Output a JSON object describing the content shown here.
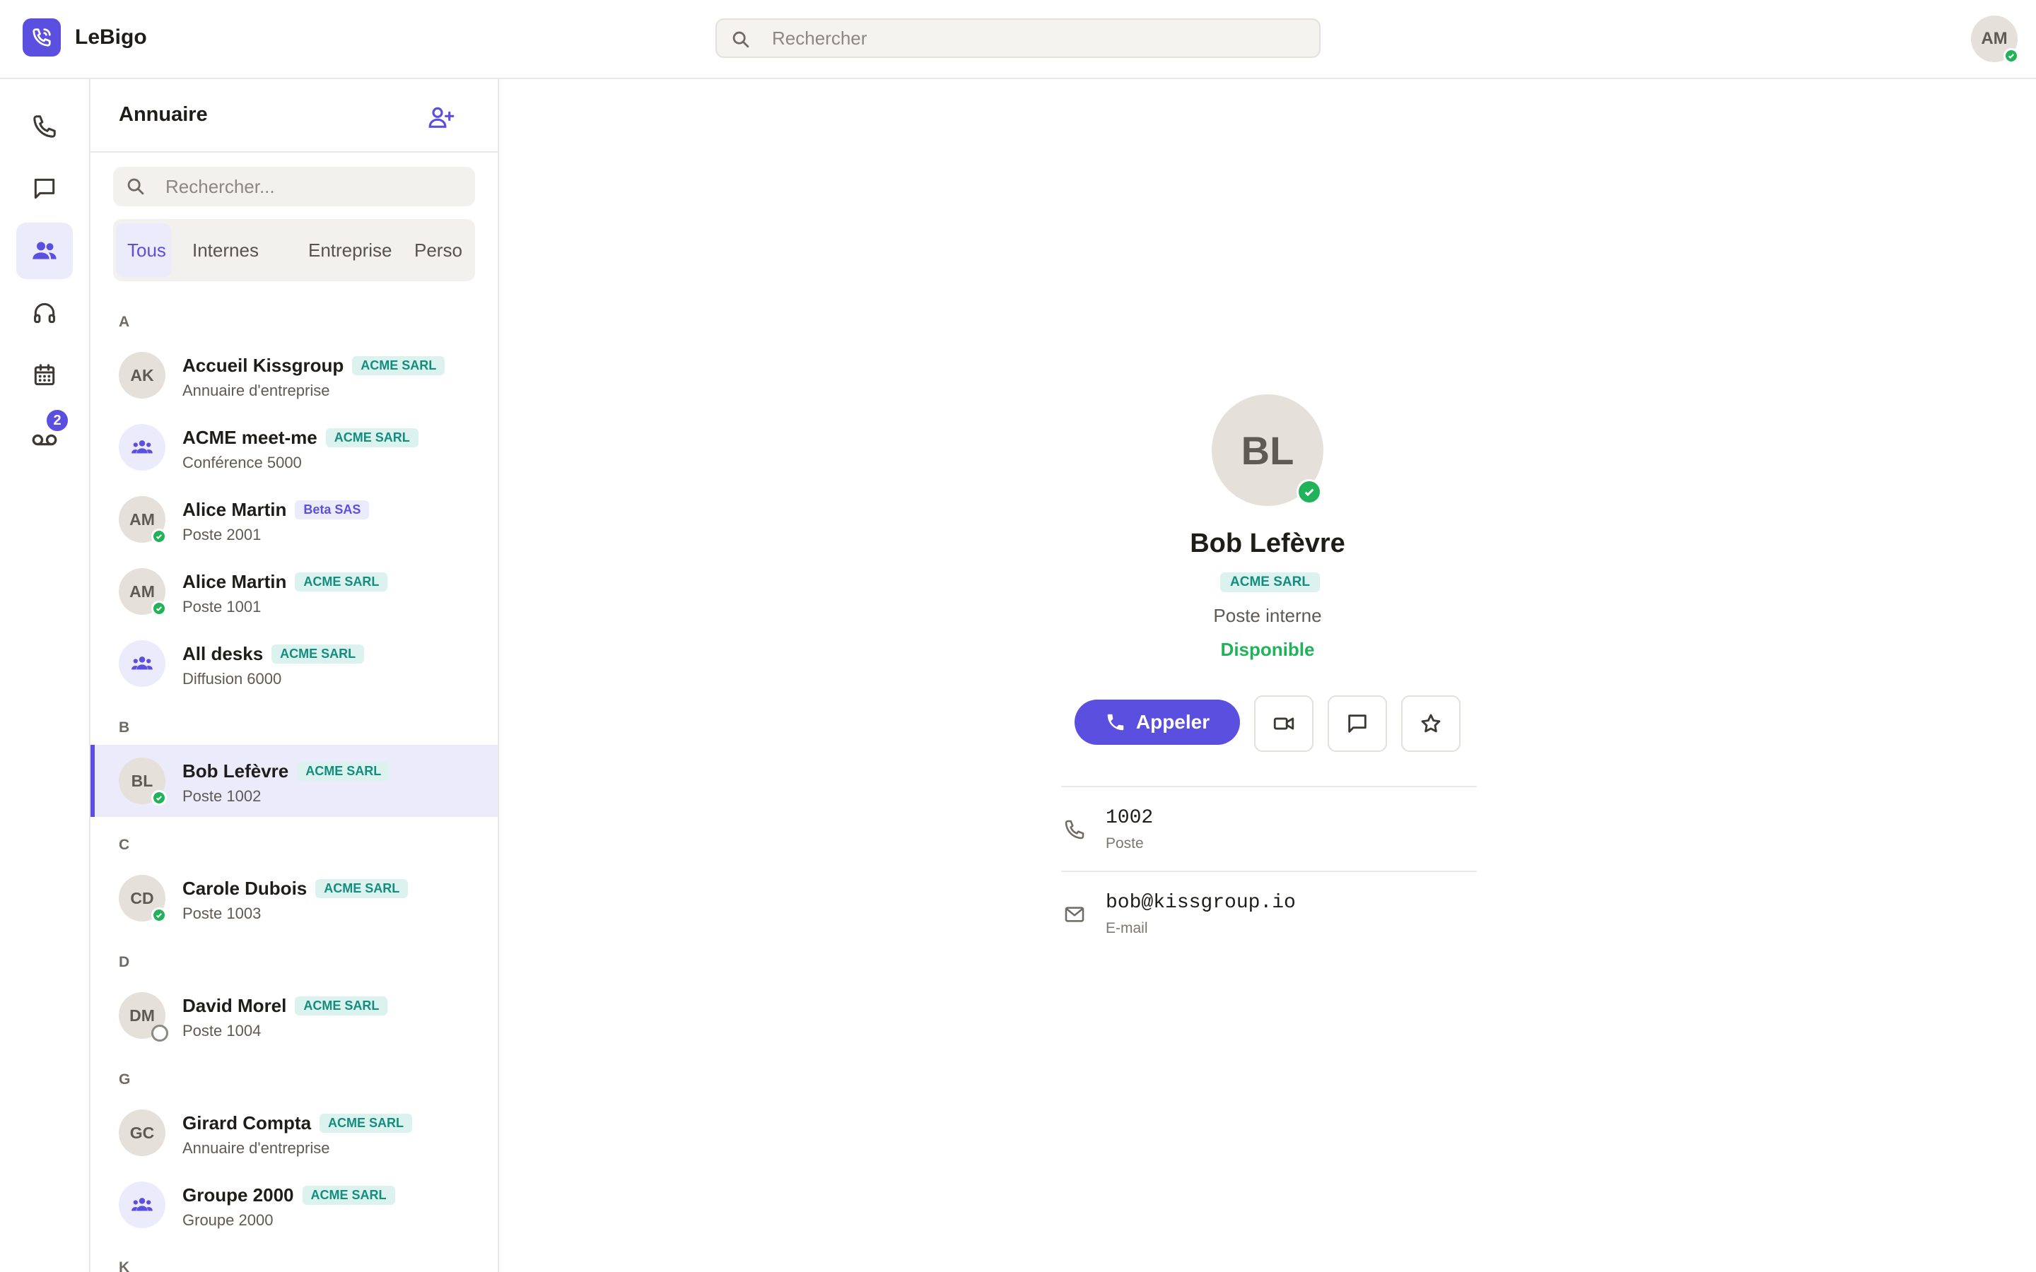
{
  "app": {
    "name": "LeBigo",
    "search_placeholder": "Rechercher",
    "user_initials": "AM"
  },
  "rail": {
    "items": [
      {
        "icon": "phone-icon",
        "active": false
      },
      {
        "icon": "chat-icon",
        "active": false
      },
      {
        "icon": "contacts-icon",
        "active": true
      },
      {
        "icon": "headset-icon",
        "active": false
      },
      {
        "icon": "calendar-icon",
        "active": false
      },
      {
        "icon": "voicemail-icon",
        "active": false,
        "badge": "2"
      }
    ]
  },
  "directory": {
    "title": "Annuaire",
    "search_placeholder": "Rechercher...",
    "filters": [
      "Tous",
      "Internes",
      "Entreprise",
      "Perso"
    ],
    "active_filter": "Tous",
    "sections": [
      {
        "letter": "A",
        "contacts": [
          {
            "initials": "AK",
            "name": "Accueil Kissgroup",
            "tag": "ACME SARL",
            "sub": "Annuaire d'entreprise",
            "type": "person",
            "status": "none"
          },
          {
            "initials": "",
            "name": "ACME meet-me",
            "tag": "ACME SARL",
            "sub": "Conférence 5000",
            "type": "group",
            "status": "none"
          },
          {
            "initials": "AM",
            "name": "Alice Martin",
            "tag": "Beta SAS",
            "sub": "Poste 2001",
            "type": "person",
            "status": "online"
          },
          {
            "initials": "AM",
            "name": "Alice Martin",
            "tag": "ACME SARL",
            "sub": "Poste 1001",
            "type": "person",
            "status": "online"
          },
          {
            "initials": "",
            "name": "All desks",
            "tag": "ACME SARL",
            "sub": "Diffusion 6000",
            "type": "group",
            "status": "none"
          }
        ]
      },
      {
        "letter": "B",
        "contacts": [
          {
            "initials": "BL",
            "name": "Bob Lefèvre",
            "tag": "ACME SARL",
            "sub": "Poste 1002",
            "type": "person",
            "status": "online",
            "selected": true
          }
        ]
      },
      {
        "letter": "C",
        "contacts": [
          {
            "initials": "CD",
            "name": "Carole Dubois",
            "tag": "ACME SARL",
            "sub": "Poste 1003",
            "type": "person",
            "status": "online"
          }
        ]
      },
      {
        "letter": "D",
        "contacts": [
          {
            "initials": "DM",
            "name": "David Morel",
            "tag": "ACME SARL",
            "sub": "Poste 1004",
            "type": "person",
            "status": "offline"
          }
        ]
      },
      {
        "letter": "G",
        "contacts": [
          {
            "initials": "GC",
            "name": "Girard Compta",
            "tag": "ACME SARL",
            "sub": "Annuaire d'entreprise",
            "type": "person",
            "status": "none"
          },
          {
            "initials": "",
            "name": "Groupe 2000",
            "tag": "ACME SARL",
            "sub": "Groupe 2000",
            "type": "group",
            "status": "none"
          }
        ]
      },
      {
        "letter": "K",
        "contacts": []
      }
    ]
  },
  "detail": {
    "initials": "BL",
    "name": "Bob Lefèvre",
    "tag": "ACME SARL",
    "role": "Poste interne",
    "status": "Disponible",
    "call_label": "Appeler",
    "extension_value": "1002",
    "extension_label": "Poste",
    "email_value": "bob@kissgroup.io",
    "email_label": "E-mail"
  },
  "colors": {
    "accent": "#5b4fe0",
    "online": "#21b35a",
    "tag_bg": "#dcf2ef",
    "tag_fg": "#128d7e"
  }
}
